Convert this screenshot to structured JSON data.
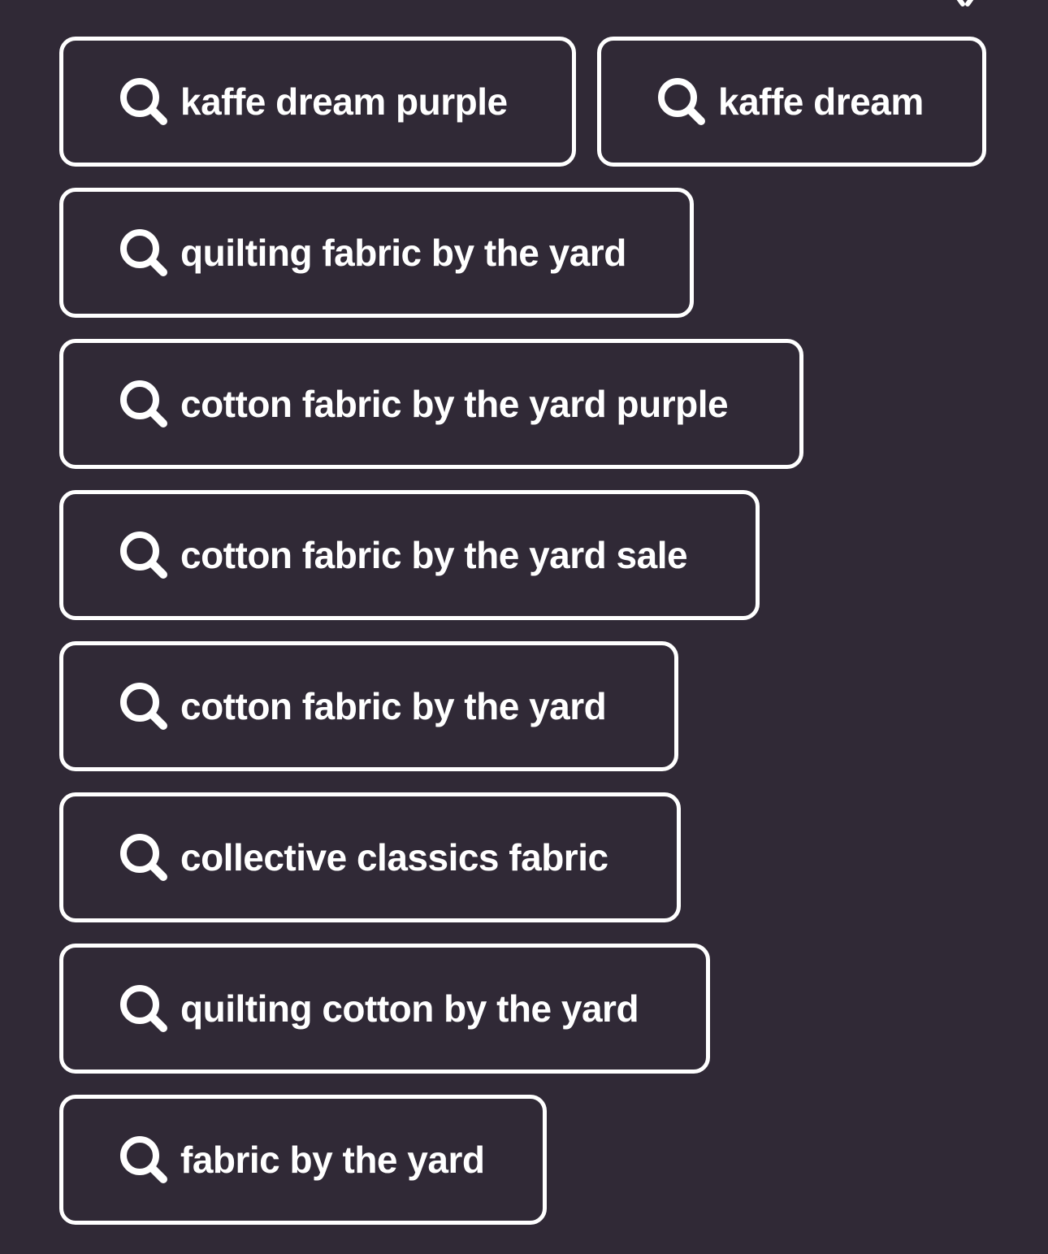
{
  "colors": {
    "background": "#302936",
    "chip_border": "#ffffff",
    "text": "#ffffff"
  },
  "close_button": {
    "icon": "close-icon"
  },
  "suggestions": [
    {
      "label": "kaffe dream purple",
      "icon": "search-icon"
    },
    {
      "label": "kaffe dream",
      "icon": "search-icon"
    },
    {
      "label": "quilting fabric by the yard",
      "icon": "search-icon"
    },
    {
      "label": "cotton fabric by the yard purple",
      "icon": "search-icon"
    },
    {
      "label": "cotton fabric by the yard sale",
      "icon": "search-icon"
    },
    {
      "label": "cotton fabric by the yard",
      "icon": "search-icon"
    },
    {
      "label": "collective classics fabric",
      "icon": "search-icon"
    },
    {
      "label": "quilting cotton by the yard",
      "icon": "search-icon"
    },
    {
      "label": "fabric by the yard",
      "icon": "search-icon"
    }
  ]
}
